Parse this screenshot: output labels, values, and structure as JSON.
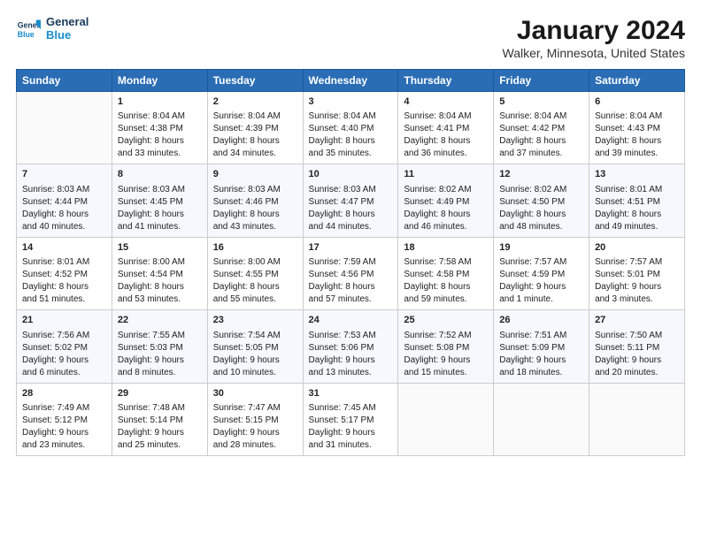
{
  "logo": {
    "line1": "General",
    "line2": "Blue"
  },
  "title": "January 2024",
  "subtitle": "Walker, Minnesota, United States",
  "days_header": [
    "Sunday",
    "Monday",
    "Tuesday",
    "Wednesday",
    "Thursday",
    "Friday",
    "Saturday"
  ],
  "weeks": [
    [
      {
        "day": "",
        "content": ""
      },
      {
        "day": "1",
        "content": "Sunrise: 8:04 AM\nSunset: 4:38 PM\nDaylight: 8 hours\nand 33 minutes."
      },
      {
        "day": "2",
        "content": "Sunrise: 8:04 AM\nSunset: 4:39 PM\nDaylight: 8 hours\nand 34 minutes."
      },
      {
        "day": "3",
        "content": "Sunrise: 8:04 AM\nSunset: 4:40 PM\nDaylight: 8 hours\nand 35 minutes."
      },
      {
        "day": "4",
        "content": "Sunrise: 8:04 AM\nSunset: 4:41 PM\nDaylight: 8 hours\nand 36 minutes."
      },
      {
        "day": "5",
        "content": "Sunrise: 8:04 AM\nSunset: 4:42 PM\nDaylight: 8 hours\nand 37 minutes."
      },
      {
        "day": "6",
        "content": "Sunrise: 8:04 AM\nSunset: 4:43 PM\nDaylight: 8 hours\nand 39 minutes."
      }
    ],
    [
      {
        "day": "7",
        "content": "Sunrise: 8:03 AM\nSunset: 4:44 PM\nDaylight: 8 hours\nand 40 minutes."
      },
      {
        "day": "8",
        "content": "Sunrise: 8:03 AM\nSunset: 4:45 PM\nDaylight: 8 hours\nand 41 minutes."
      },
      {
        "day": "9",
        "content": "Sunrise: 8:03 AM\nSunset: 4:46 PM\nDaylight: 8 hours\nand 43 minutes."
      },
      {
        "day": "10",
        "content": "Sunrise: 8:03 AM\nSunset: 4:47 PM\nDaylight: 8 hours\nand 44 minutes."
      },
      {
        "day": "11",
        "content": "Sunrise: 8:02 AM\nSunset: 4:49 PM\nDaylight: 8 hours\nand 46 minutes."
      },
      {
        "day": "12",
        "content": "Sunrise: 8:02 AM\nSunset: 4:50 PM\nDaylight: 8 hours\nand 48 minutes."
      },
      {
        "day": "13",
        "content": "Sunrise: 8:01 AM\nSunset: 4:51 PM\nDaylight: 8 hours\nand 49 minutes."
      }
    ],
    [
      {
        "day": "14",
        "content": "Sunrise: 8:01 AM\nSunset: 4:52 PM\nDaylight: 8 hours\nand 51 minutes."
      },
      {
        "day": "15",
        "content": "Sunrise: 8:00 AM\nSunset: 4:54 PM\nDaylight: 8 hours\nand 53 minutes."
      },
      {
        "day": "16",
        "content": "Sunrise: 8:00 AM\nSunset: 4:55 PM\nDaylight: 8 hours\nand 55 minutes."
      },
      {
        "day": "17",
        "content": "Sunrise: 7:59 AM\nSunset: 4:56 PM\nDaylight: 8 hours\nand 57 minutes."
      },
      {
        "day": "18",
        "content": "Sunrise: 7:58 AM\nSunset: 4:58 PM\nDaylight: 8 hours\nand 59 minutes."
      },
      {
        "day": "19",
        "content": "Sunrise: 7:57 AM\nSunset: 4:59 PM\nDaylight: 9 hours\nand 1 minute."
      },
      {
        "day": "20",
        "content": "Sunrise: 7:57 AM\nSunset: 5:01 PM\nDaylight: 9 hours\nand 3 minutes."
      }
    ],
    [
      {
        "day": "21",
        "content": "Sunrise: 7:56 AM\nSunset: 5:02 PM\nDaylight: 9 hours\nand 6 minutes."
      },
      {
        "day": "22",
        "content": "Sunrise: 7:55 AM\nSunset: 5:03 PM\nDaylight: 9 hours\nand 8 minutes."
      },
      {
        "day": "23",
        "content": "Sunrise: 7:54 AM\nSunset: 5:05 PM\nDaylight: 9 hours\nand 10 minutes."
      },
      {
        "day": "24",
        "content": "Sunrise: 7:53 AM\nSunset: 5:06 PM\nDaylight: 9 hours\nand 13 minutes."
      },
      {
        "day": "25",
        "content": "Sunrise: 7:52 AM\nSunset: 5:08 PM\nDaylight: 9 hours\nand 15 minutes."
      },
      {
        "day": "26",
        "content": "Sunrise: 7:51 AM\nSunset: 5:09 PM\nDaylight: 9 hours\nand 18 minutes."
      },
      {
        "day": "27",
        "content": "Sunrise: 7:50 AM\nSunset: 5:11 PM\nDaylight: 9 hours\nand 20 minutes."
      }
    ],
    [
      {
        "day": "28",
        "content": "Sunrise: 7:49 AM\nSunset: 5:12 PM\nDaylight: 9 hours\nand 23 minutes."
      },
      {
        "day": "29",
        "content": "Sunrise: 7:48 AM\nSunset: 5:14 PM\nDaylight: 9 hours\nand 25 minutes."
      },
      {
        "day": "30",
        "content": "Sunrise: 7:47 AM\nSunset: 5:15 PM\nDaylight: 9 hours\nand 28 minutes."
      },
      {
        "day": "31",
        "content": "Sunrise: 7:45 AM\nSunset: 5:17 PM\nDaylight: 9 hours\nand 31 minutes."
      },
      {
        "day": "",
        "content": ""
      },
      {
        "day": "",
        "content": ""
      },
      {
        "day": "",
        "content": ""
      }
    ]
  ]
}
